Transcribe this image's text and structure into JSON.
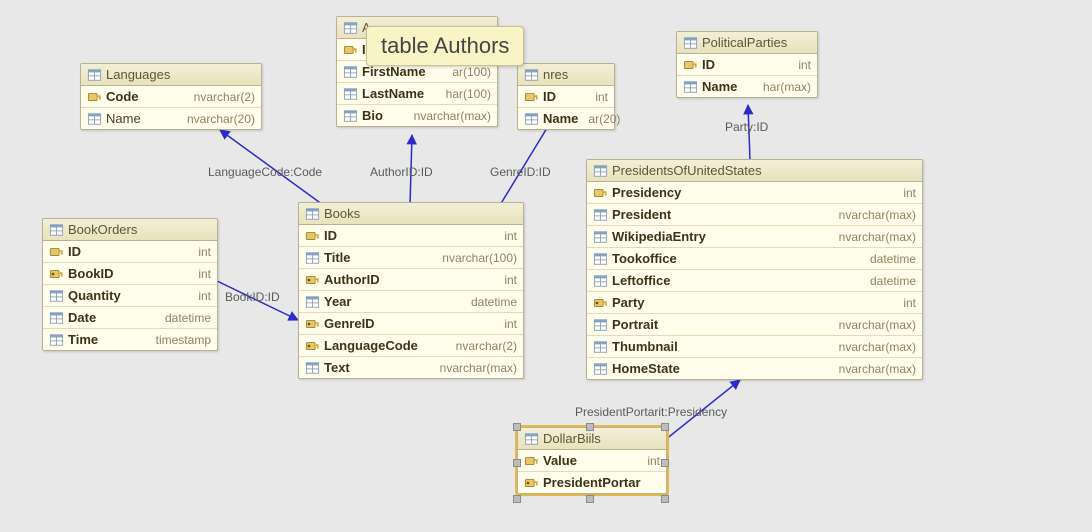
{
  "tooltip": "table Authors",
  "relations": [
    {
      "label": "LanguageCode:Code"
    },
    {
      "label": "AuthorID:ID"
    },
    {
      "label": "GenreID:ID"
    },
    {
      "label": "BookID:ID"
    },
    {
      "label": "Party:ID"
    },
    {
      "label": "PresidentPortarit:Presidency"
    }
  ],
  "tables": {
    "Languages": {
      "title": "Languages",
      "cols": [
        {
          "icon": "pk",
          "name": "Code",
          "type": "nvarchar(2)",
          "bold": true
        },
        {
          "icon": "col",
          "name": "Name",
          "type": "nvarchar(20)",
          "bold": false
        }
      ]
    },
    "Authors": {
      "title": "A",
      "cols": [
        {
          "icon": "pk",
          "name": "ID",
          "type": "",
          "bold": true
        },
        {
          "icon": "col",
          "name": "FirstName",
          "type": "ar(100)",
          "bold": true
        },
        {
          "icon": "col",
          "name": "LastName",
          "type": "har(100)",
          "bold": true
        },
        {
          "icon": "col",
          "name": "Bio",
          "type": "nvarchar(max)",
          "bold": true
        }
      ]
    },
    "Genres": {
      "title": "nres",
      "cols": [
        {
          "icon": "pk",
          "name": "ID",
          "type": "int",
          "bold": true
        },
        {
          "icon": "col",
          "name": "Name",
          "type": "ar(20)",
          "bold": true
        }
      ]
    },
    "PoliticalParties": {
      "title": "PoliticalParties",
      "cols": [
        {
          "icon": "pk",
          "name": "ID",
          "type": "int",
          "bold": true
        },
        {
          "icon": "col",
          "name": "Name",
          "type": "har(max)",
          "bold": true
        }
      ]
    },
    "BookOrders": {
      "title": "BookOrders",
      "cols": [
        {
          "icon": "pk",
          "name": "ID",
          "type": "int",
          "bold": true
        },
        {
          "icon": "fk",
          "name": "BookID",
          "type": "int",
          "bold": true
        },
        {
          "icon": "col",
          "name": "Quantity",
          "type": "int",
          "bold": true
        },
        {
          "icon": "col",
          "name": "Date",
          "type": "datetime",
          "bold": true
        },
        {
          "icon": "col",
          "name": "Time",
          "type": "timestamp",
          "bold": true
        }
      ]
    },
    "Books": {
      "title": "Books",
      "cols": [
        {
          "icon": "pk",
          "name": "ID",
          "type": "int",
          "bold": true
        },
        {
          "icon": "col",
          "name": "Title",
          "type": "nvarchar(100)",
          "bold": true
        },
        {
          "icon": "fk",
          "name": "AuthorID",
          "type": "int",
          "bold": true
        },
        {
          "icon": "col",
          "name": "Year",
          "type": "datetime",
          "bold": true
        },
        {
          "icon": "fk",
          "name": "GenreID",
          "type": "int",
          "bold": true
        },
        {
          "icon": "fk",
          "name": "LanguageCode",
          "type": "nvarchar(2)",
          "bold": true
        },
        {
          "icon": "col",
          "name": "Text",
          "type": "nvarchar(max)",
          "bold": true
        }
      ]
    },
    "Presidents": {
      "title": "PresidentsOfUnitedStates",
      "cols": [
        {
          "icon": "pk",
          "name": "Presidency",
          "type": "int",
          "bold": true
        },
        {
          "icon": "col",
          "name": "President",
          "type": "nvarchar(max)",
          "bold": true
        },
        {
          "icon": "col",
          "name": "WikipediaEntry",
          "type": "nvarchar(max)",
          "bold": true
        },
        {
          "icon": "col",
          "name": "Tookoffice",
          "type": "datetime",
          "bold": true
        },
        {
          "icon": "col",
          "name": "Leftoffice",
          "type": "datetime",
          "bold": true
        },
        {
          "icon": "fk",
          "name": "Party",
          "type": "int",
          "bold": true
        },
        {
          "icon": "col",
          "name": "Portrait",
          "type": "nvarchar(max)",
          "bold": true
        },
        {
          "icon": "col",
          "name": "Thumbnail",
          "type": "nvarchar(max)",
          "bold": true
        },
        {
          "icon": "col",
          "name": "HomeState",
          "type": "nvarchar(max)",
          "bold": true
        }
      ]
    },
    "DollarBills": {
      "title": "DollarBiils",
      "cols": [
        {
          "icon": "pk",
          "name": "Value",
          "type": "int",
          "bold": true
        },
        {
          "icon": "fk",
          "name": "PresidentPortar",
          "type": "",
          "bold": true
        }
      ]
    }
  }
}
